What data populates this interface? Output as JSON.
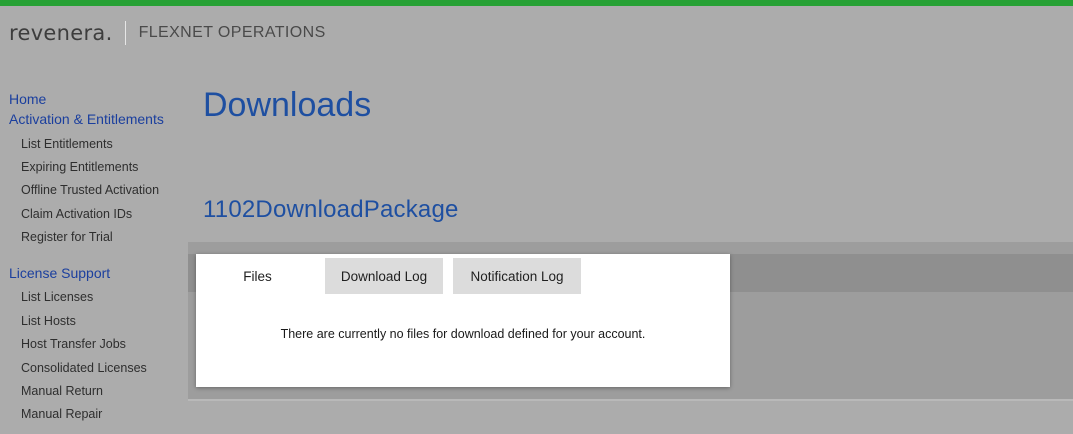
{
  "brand": {
    "name": "revenera.",
    "product": "FLEXNET OPERATIONS",
    "accent_color": "#27a135"
  },
  "sidebar": {
    "sections": [
      {
        "label": "Home",
        "items": []
      },
      {
        "label": "Activation & Entitlements",
        "items": [
          "List Entitlements",
          "Expiring Entitlements",
          "Offline Trusted Activation",
          "Claim Activation IDs",
          "Register for Trial"
        ]
      },
      {
        "label": "License Support",
        "items": [
          "List Licenses",
          "List Hosts",
          "Host Transfer Jobs",
          "Consolidated Licenses",
          "Manual Return",
          "Manual Repair"
        ]
      }
    ]
  },
  "main": {
    "title": "Downloads",
    "package_name": "1102DownloadPackage",
    "tabs": [
      {
        "label": "Files",
        "active": true
      },
      {
        "label": "Download Log",
        "active": false
      },
      {
        "label": "Notification Log",
        "active": false
      }
    ],
    "empty_message": "There are currently no files for download defined for your account."
  }
}
